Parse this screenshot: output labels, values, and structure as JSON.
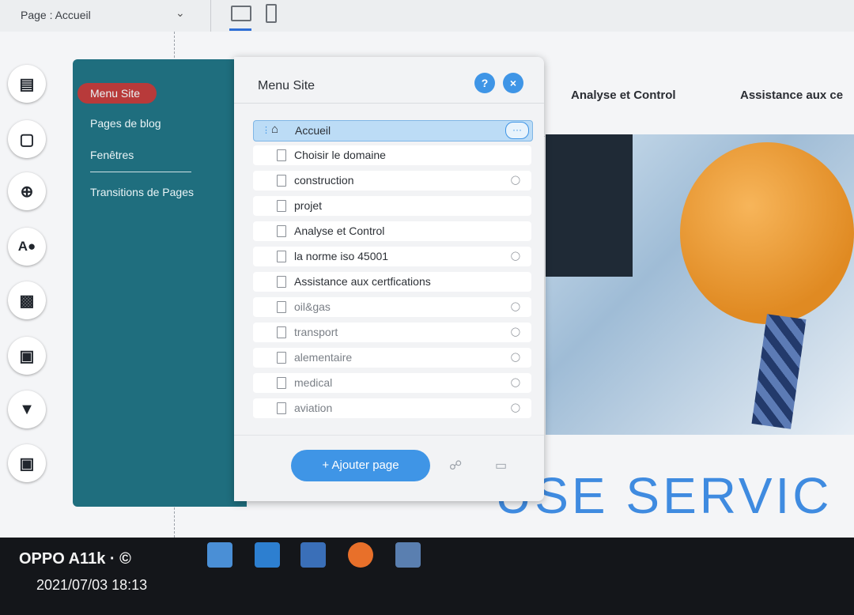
{
  "editor": {
    "page_select_label": "Page : Accueil",
    "chevron": "chevron-down-icon"
  },
  "site_nav": {
    "link1": "Analyse et Control",
    "link2": "Assistance aux ce"
  },
  "hero_title": "USE SERVIC",
  "menus_panel": {
    "items": [
      {
        "label": "Menu Site"
      },
      {
        "label": "Pages de blog"
      },
      {
        "label": "Fenêtres"
      },
      {
        "label": "Transitions de Pages"
      }
    ]
  },
  "site_menu": {
    "title": "Menu Site",
    "help_label": "?",
    "close_label": "×",
    "pages": [
      {
        "label": "Accueil",
        "hidden": false,
        "selected": true
      },
      {
        "label": "Choisir le domaine",
        "hidden": false
      },
      {
        "label": "construction",
        "hidden": true
      },
      {
        "label": "projet",
        "hidden": false
      },
      {
        "label": "Analyse et Control",
        "hidden": false
      },
      {
        "label": "la norme iso 45001",
        "hidden": true
      },
      {
        "label": "Assistance aux certfications",
        "hidden": false
      },
      {
        "label": "oil&gas",
        "hidden": true
      },
      {
        "label": "transport",
        "hidden": true
      },
      {
        "label": "alementaire",
        "hidden": true
      },
      {
        "label": "medical",
        "hidden": true
      },
      {
        "label": "aviation",
        "hidden": true
      }
    ],
    "more_label": "···",
    "add_page_label": "+ Ajouter page"
  },
  "taskbar": {
    "watermark": "OPPO A11k · ©",
    "timestamp": "2021/07/03 18:13"
  },
  "colors": {
    "accent": "#3f95e6",
    "panel_teal": "#1f6e7e",
    "active_pill": "#b83a3a"
  }
}
